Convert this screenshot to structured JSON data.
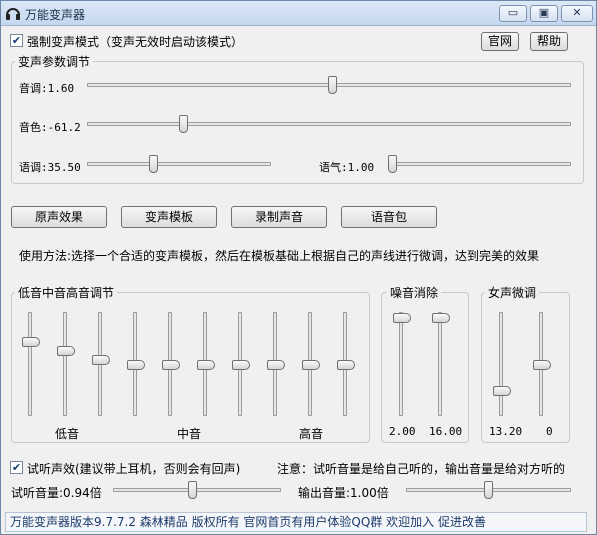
{
  "window": {
    "title": "万能变声器",
    "min_label": "▭",
    "max_label": "▣",
    "close_label": "✕"
  },
  "top": {
    "force_mode_label": "强制变声模式（变声无效时启动该模式）",
    "force_mode_checked": true,
    "official_site_button": "官网",
    "help_button": "帮助"
  },
  "params": {
    "group_title": "变声参数调节",
    "pitch_label": "音调:1.60",
    "pitch_value": 1.6,
    "timbre_label": "音色:-61.2",
    "timbre_value": -61.2,
    "tone_label": "语调:35.50",
    "tone_value": 35.5,
    "mood_label": "语气:1.00",
    "mood_value": 1.0
  },
  "buttons": {
    "original": "原声效果",
    "templates": "变声模板",
    "record": "录制声音",
    "voice_pack": "语音包"
  },
  "usage_text": "使用方法:选择一个合适的变声模板，然后在模板基础上根据自己的声线进行微调，达到完美的效果",
  "eq": {
    "group_title": "低音中音高音调节",
    "low_label": "低音",
    "mid_label": "中音",
    "high_label": "高音",
    "bands": 10
  },
  "noise": {
    "group_title": "噪音消除",
    "value1": "2.00",
    "value2": "16.00"
  },
  "female": {
    "group_title": "女声微调",
    "value1": "13.20",
    "value2": "0"
  },
  "monitor": {
    "label": "试听声效(建议带上耳机，否则会有回声)",
    "checked": true,
    "note": "注意：试听音量是给自己听的，输出音量是给对方听的",
    "monitor_volume_label": "试听音量:0.94倍",
    "monitor_volume": 0.94,
    "output_volume_label": "输出音量:1.00倍",
    "output_volume": 1.0
  },
  "status_bar": "万能变声器版本9.7.7.2   森林精品  版权所有   官网首页有用户体验QQ群 欢迎加入 促进改善"
}
